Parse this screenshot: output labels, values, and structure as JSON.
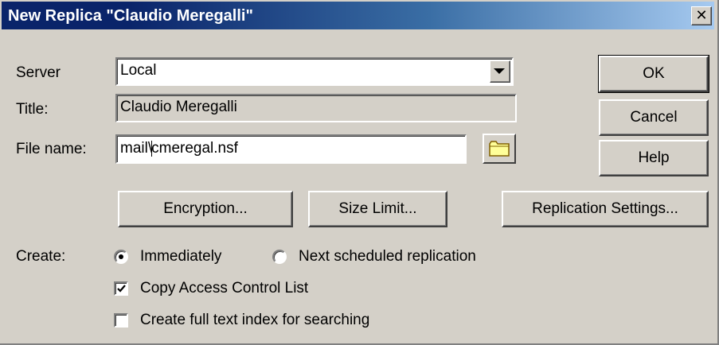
{
  "window": {
    "title": "New Replica \"Claudio Meregalli\"",
    "close_glyph": "✕"
  },
  "form": {
    "server_label": "Server",
    "server_value": "Local",
    "title_label": "Title:",
    "title_value": "Claudio Meregalli",
    "filename_label": "File name:",
    "filename_before_caret": "mail\\",
    "filename_after_caret": "cmeregal.nsf"
  },
  "buttons": {
    "ok": "OK",
    "cancel": "Cancel",
    "help": "Help",
    "encryption": "Encryption...",
    "size_limit": "Size Limit...",
    "replication_settings": "Replication Settings..."
  },
  "create": {
    "label": "Create:",
    "options": [
      {
        "label": "Immediately",
        "selected": true
      },
      {
        "label": "Next scheduled replication",
        "selected": false
      }
    ],
    "checkboxes": [
      {
        "label": "Copy Access Control List",
        "checked": true
      },
      {
        "label": "Create full text index for searching",
        "checked": false
      }
    ]
  },
  "icons": {
    "close": "close-icon",
    "dropdown": "chevron-down-icon",
    "browse": "folder-icon"
  }
}
